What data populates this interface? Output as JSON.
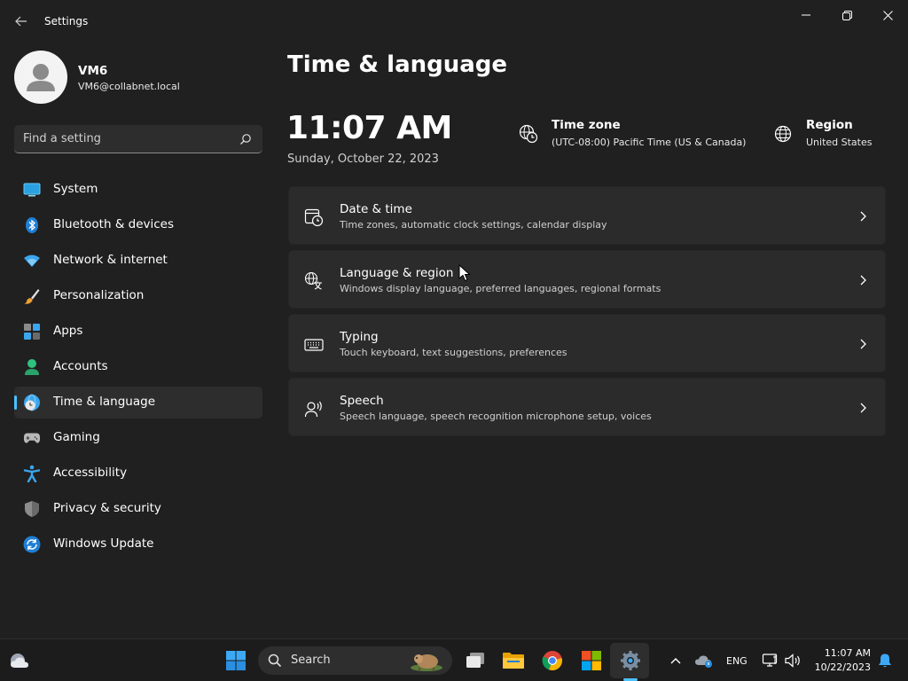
{
  "window": {
    "title": "Settings"
  },
  "profile": {
    "name": "VM6",
    "email": "VM6@collabnet.local"
  },
  "search": {
    "placeholder": "Find a setting"
  },
  "nav": {
    "items": [
      {
        "label": "System",
        "icon": "system-icon"
      },
      {
        "label": "Bluetooth & devices",
        "icon": "bluetooth-icon"
      },
      {
        "label": "Network & internet",
        "icon": "wifi-icon"
      },
      {
        "label": "Personalization",
        "icon": "brush-icon"
      },
      {
        "label": "Apps",
        "icon": "apps-icon"
      },
      {
        "label": "Accounts",
        "icon": "person-icon"
      },
      {
        "label": "Time & language",
        "icon": "globe-clock-icon",
        "selected": true
      },
      {
        "label": "Gaming",
        "icon": "gamepad-icon"
      },
      {
        "label": "Accessibility",
        "icon": "accessibility-icon"
      },
      {
        "label": "Privacy & security",
        "icon": "shield-icon"
      },
      {
        "label": "Windows Update",
        "icon": "update-icon"
      }
    ]
  },
  "main": {
    "title": "Time & language",
    "clock": {
      "time": "11:07 AM",
      "date": "Sunday, October 22, 2023"
    },
    "time_zone": {
      "title": "Time zone",
      "value": "(UTC-08:00) Pacific Time (US & Canada)"
    },
    "region": {
      "title": "Region",
      "value": "United States"
    },
    "cards": [
      {
        "title": "Date & time",
        "desc": "Time zones, automatic clock settings, calendar display",
        "icon": "calendar-clock-icon"
      },
      {
        "title": "Language & region",
        "desc": "Windows display language, preferred languages, regional formats",
        "icon": "language-icon"
      },
      {
        "title": "Typing",
        "desc": "Touch keyboard, text suggestions, preferences",
        "icon": "keyboard-icon"
      },
      {
        "title": "Speech",
        "desc": "Speech language, speech recognition microphone setup, voices",
        "icon": "speech-icon"
      }
    ]
  },
  "taskbar": {
    "search_label": "Search",
    "language": "ENG",
    "time": "11:07 AM",
    "date": "10/22/2023"
  },
  "colors": {
    "accent": "#4cc2ff",
    "background": "#202020",
    "card": "#2b2b2b",
    "selected_nav": "#2d2d2d",
    "taskbar": "#1c1c1c"
  }
}
